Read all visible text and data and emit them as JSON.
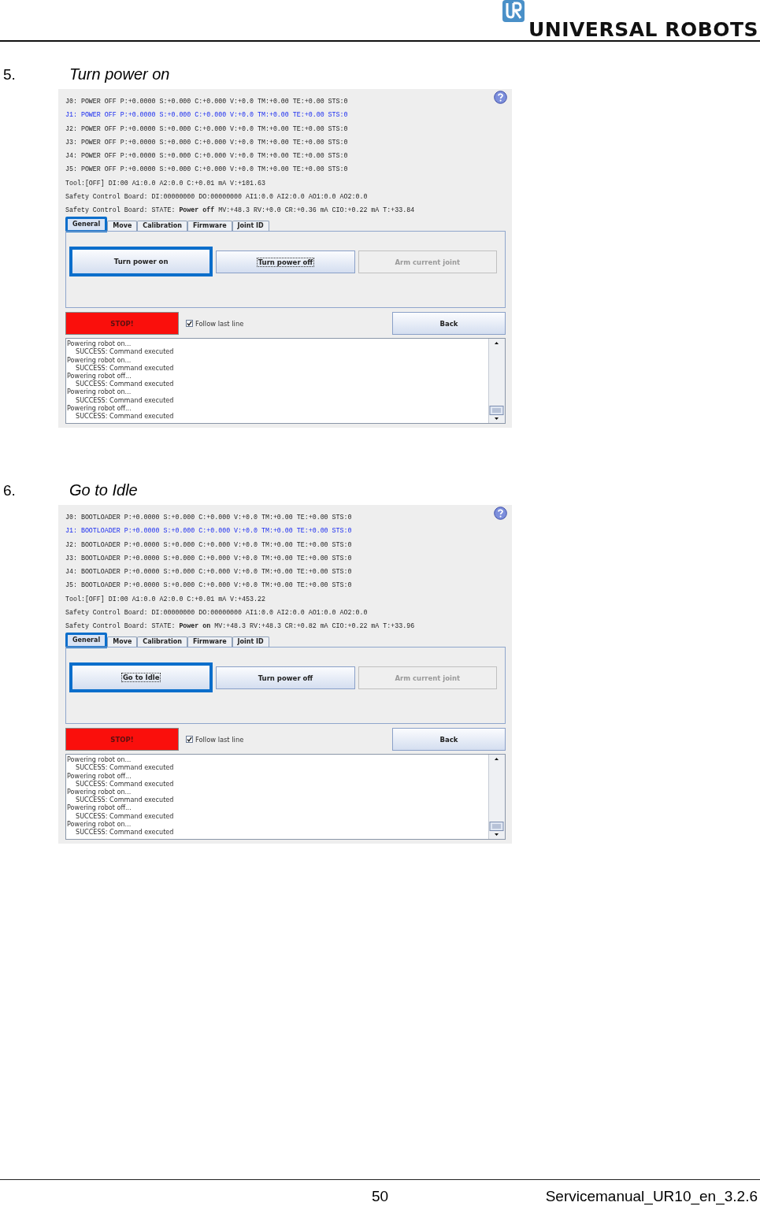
{
  "header": {
    "brand": "UNIVERSAL ROBOTS"
  },
  "steps": [
    {
      "number": "5.",
      "title": "Turn power on",
      "screen": {
        "joints": [
          {
            "text": "J0: POWER OFF P:+0.0000 S:+0.000 C:+0.000 V:+0.0 TM:+0.00 TE:+0.00 STS:0",
            "selected": false
          },
          {
            "text": "J1: POWER OFF P:+0.0000 S:+0.000 C:+0.000 V:+0.0 TM:+0.00 TE:+0.00 STS:0",
            "selected": true
          },
          {
            "text": "J2: POWER OFF P:+0.0000 S:+0.000 C:+0.000 V:+0.0 TM:+0.00 TE:+0.00 STS:0",
            "selected": false
          },
          {
            "text": "J3: POWER OFF P:+0.0000 S:+0.000 C:+0.000 V:+0.0 TM:+0.00 TE:+0.00 STS:0",
            "selected": false
          },
          {
            "text": "J4: POWER OFF P:+0.0000 S:+0.000 C:+0.000 V:+0.0 TM:+0.00 TE:+0.00 STS:0",
            "selected": false
          },
          {
            "text": "J5: POWER OFF P:+0.0000 S:+0.000 C:+0.000 V:+0.0 TM:+0.00 TE:+0.00 STS:0",
            "selected": false
          }
        ],
        "tool": "Tool:[OFF] DI:00  A1:0.0 A2:0.0 C:+0.01 mA V:+101.63",
        "safety_io": "Safety Control Board: DI:00000000 DO:00000000 AI1:0.0 AI2:0.0 AO1:0.0 AO2:0.0",
        "safety_state": "Safety Control Board: STATE: **Power off** MV:+48.3 RV:+0.0 CR:+0.36 mA CIO:+0.22 mA T:+33.84",
        "tabs": [
          {
            "label": "General",
            "selected": true,
            "highlighted": true
          },
          {
            "label": "Move",
            "selected": false,
            "highlighted": false
          },
          {
            "label": "Calibration",
            "selected": false,
            "highlighted": false
          },
          {
            "label": "Firmware",
            "selected": false,
            "highlighted": false
          },
          {
            "label": "Joint ID",
            "selected": false,
            "highlighted": false
          }
        ],
        "buttons": [
          {
            "label": "Turn power on",
            "disabled": false,
            "highlighted": true,
            "focused": false
          },
          {
            "label": "Turn power off",
            "disabled": false,
            "highlighted": false,
            "focused": true
          },
          {
            "label": "Arm current joint",
            "disabled": true,
            "highlighted": false,
            "focused": false
          }
        ],
        "stop": "STOP!",
        "follow": {
          "label": "Follow last line",
          "checked": true
        },
        "back": "Back",
        "log": [
          {
            "text": "Powering robot on...",
            "kind": "action"
          },
          {
            "text": "SUCCESS: Command executed",
            "kind": "result"
          },
          {
            "text": "Powering robot on...",
            "kind": "action"
          },
          {
            "text": "SUCCESS: Command executed",
            "kind": "result"
          },
          {
            "text": "Powering robot off...",
            "kind": "action"
          },
          {
            "text": "SUCCESS: Command executed",
            "kind": "result"
          },
          {
            "text": "Powering robot on...",
            "kind": "action"
          },
          {
            "text": "SUCCESS: Command executed",
            "kind": "result"
          },
          {
            "text": "Powering robot off...",
            "kind": "action"
          },
          {
            "text": "SUCCESS: Command executed",
            "kind": "result"
          }
        ]
      }
    },
    {
      "number": "6.",
      "title": "Go to Idle",
      "screen": {
        "joints": [
          {
            "text": "J0: BOOTLOADER P:+0.0000 S:+0.000 C:+0.000 V:+0.0 TM:+0.00 TE:+0.00 STS:0",
            "selected": false
          },
          {
            "text": "J1: BOOTLOADER P:+0.0000 S:+0.000 C:+0.000 V:+0.0 TM:+0.00 TE:+0.00 STS:0",
            "selected": true
          },
          {
            "text": "J2: BOOTLOADER P:+0.0000 S:+0.000 C:+0.000 V:+0.0 TM:+0.00 TE:+0.00 STS:0",
            "selected": false
          },
          {
            "text": "J3: BOOTLOADER P:+0.0000 S:+0.000 C:+0.000 V:+0.0 TM:+0.00 TE:+0.00 STS:0",
            "selected": false
          },
          {
            "text": "J4: BOOTLOADER P:+0.0000 S:+0.000 C:+0.000 V:+0.0 TM:+0.00 TE:+0.00 STS:0",
            "selected": false
          },
          {
            "text": "J5: BOOTLOADER P:+0.0000 S:+0.000 C:+0.000 V:+0.0 TM:+0.00 TE:+0.00 STS:0",
            "selected": false
          }
        ],
        "tool": "Tool:[OFF] DI:00  A1:0.0 A2:0.0 C:+0.01 mA V:+453.22",
        "safety_io": "Safety Control Board: DI:00000000 DO:00000000 AI1:0.0 AI2:0.0 AO1:0.0 AO2:0.0",
        "safety_state": "Safety Control Board: STATE: **Power on** MV:+48.3 RV:+48.3 CR:+0.82 mA CIO:+0.22 mA T:+33.96",
        "tabs": [
          {
            "label": "General",
            "selected": true,
            "highlighted": true
          },
          {
            "label": "Move",
            "selected": false,
            "highlighted": false
          },
          {
            "label": "Calibration",
            "selected": false,
            "highlighted": false
          },
          {
            "label": "Firmware",
            "selected": false,
            "highlighted": false
          },
          {
            "label": "Joint ID",
            "selected": false,
            "highlighted": false
          }
        ],
        "buttons": [
          {
            "label": "Go to Idle",
            "disabled": false,
            "highlighted": true,
            "focused": true
          },
          {
            "label": "Turn power off",
            "disabled": false,
            "highlighted": false,
            "focused": false
          },
          {
            "label": "Arm current joint",
            "disabled": true,
            "highlighted": false,
            "focused": false
          }
        ],
        "stop": "STOP!",
        "follow": {
          "label": "Follow last line",
          "checked": true
        },
        "back": "Back",
        "log": [
          {
            "text": "Powering robot on...",
            "kind": "action"
          },
          {
            "text": "SUCCESS: Command executed",
            "kind": "result"
          },
          {
            "text": "Powering robot off...",
            "kind": "action"
          },
          {
            "text": "SUCCESS: Command executed",
            "kind": "result"
          },
          {
            "text": "Powering robot on...",
            "kind": "action"
          },
          {
            "text": "SUCCESS: Command executed",
            "kind": "result"
          },
          {
            "text": "Powering robot off...",
            "kind": "action"
          },
          {
            "text": "SUCCESS: Command executed",
            "kind": "result"
          },
          {
            "text": "Powering robot on...",
            "kind": "action"
          },
          {
            "text": "SUCCESS: Command executed",
            "kind": "result"
          }
        ]
      }
    }
  ],
  "footer": {
    "page": "50",
    "document": "Servicemanual_UR10_en_3.2.6"
  }
}
